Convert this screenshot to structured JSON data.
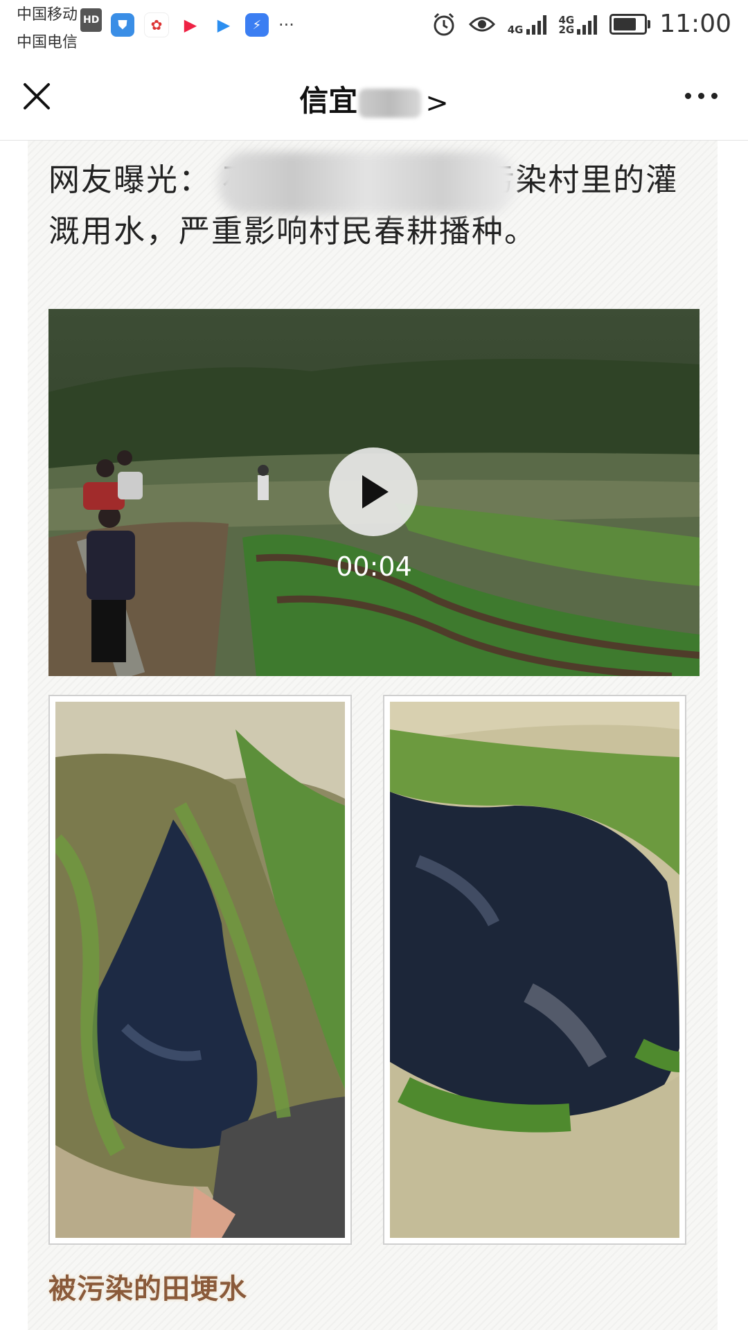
{
  "status_bar": {
    "carrier_1": "中国移动",
    "carrier_1_badge": "HD",
    "carrier_2": "中国电信",
    "notification_icons": [
      "shield-app-icon",
      "baidu-app-icon",
      "video-app-icon",
      "youku-app-icon",
      "thunder-app-icon"
    ],
    "more_notifications": "···",
    "network_1": "4G",
    "network_2": "4G",
    "network_3": "2G",
    "time": "11:00"
  },
  "titlebar": {
    "title": "信宜",
    "title_chevron": ">",
    "close_icon": "close-icon",
    "more_icon": "more-icon"
  },
  "article": {
    "headline": "网友曝光：                         石场废油乱排放，污染村里的灌溉用水，严重影响村民春耕播种。",
    "video": {
      "duration": "00:04",
      "play_icon": "play-icon"
    },
    "photos": [
      "polluted-ditch-left",
      "polluted-ditch-right"
    ],
    "caption": "被污染的田埂水"
  },
  "colors": {
    "caption": "#8a5a3a",
    "background_stripe": "#f0f0ee",
    "divider": "#e2e2e2"
  }
}
